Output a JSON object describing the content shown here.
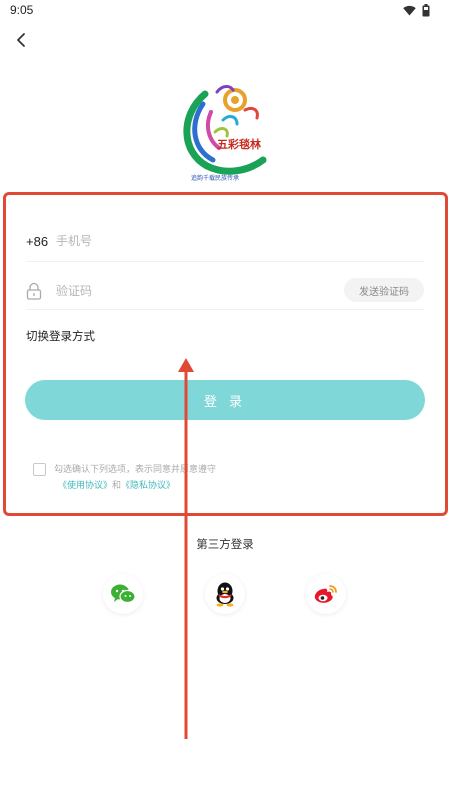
{
  "status_bar": {
    "time": "9:05",
    "icons": [
      "wifi-icon",
      "battery-icon"
    ]
  },
  "header": {
    "back_icon": "chevron-left-icon"
  },
  "logo": {
    "line1": "五彩毯林",
    "line2": "追韵千载民族传承"
  },
  "form": {
    "phone_prefix": "+86",
    "phone_placeholder": "手机号",
    "code_placeholder": "验证码",
    "send_code_label": "发送验证码",
    "switch_mode_label": "切换登录方式",
    "login_label": "登 录"
  },
  "agreement": {
    "text": "勾选确认下列选项，表示同意并愿意遵守",
    "terms_label": "《使用协议》",
    "and_label": "和",
    "privacy_label": "《隐私协议》"
  },
  "third_party": {
    "title": "第三方登录",
    "providers": [
      "wechat-icon",
      "qq-icon",
      "weibo-icon"
    ]
  },
  "colors": {
    "accent": "#80d7d8",
    "link": "#3fb8bd",
    "annotation": "#e04a35"
  }
}
